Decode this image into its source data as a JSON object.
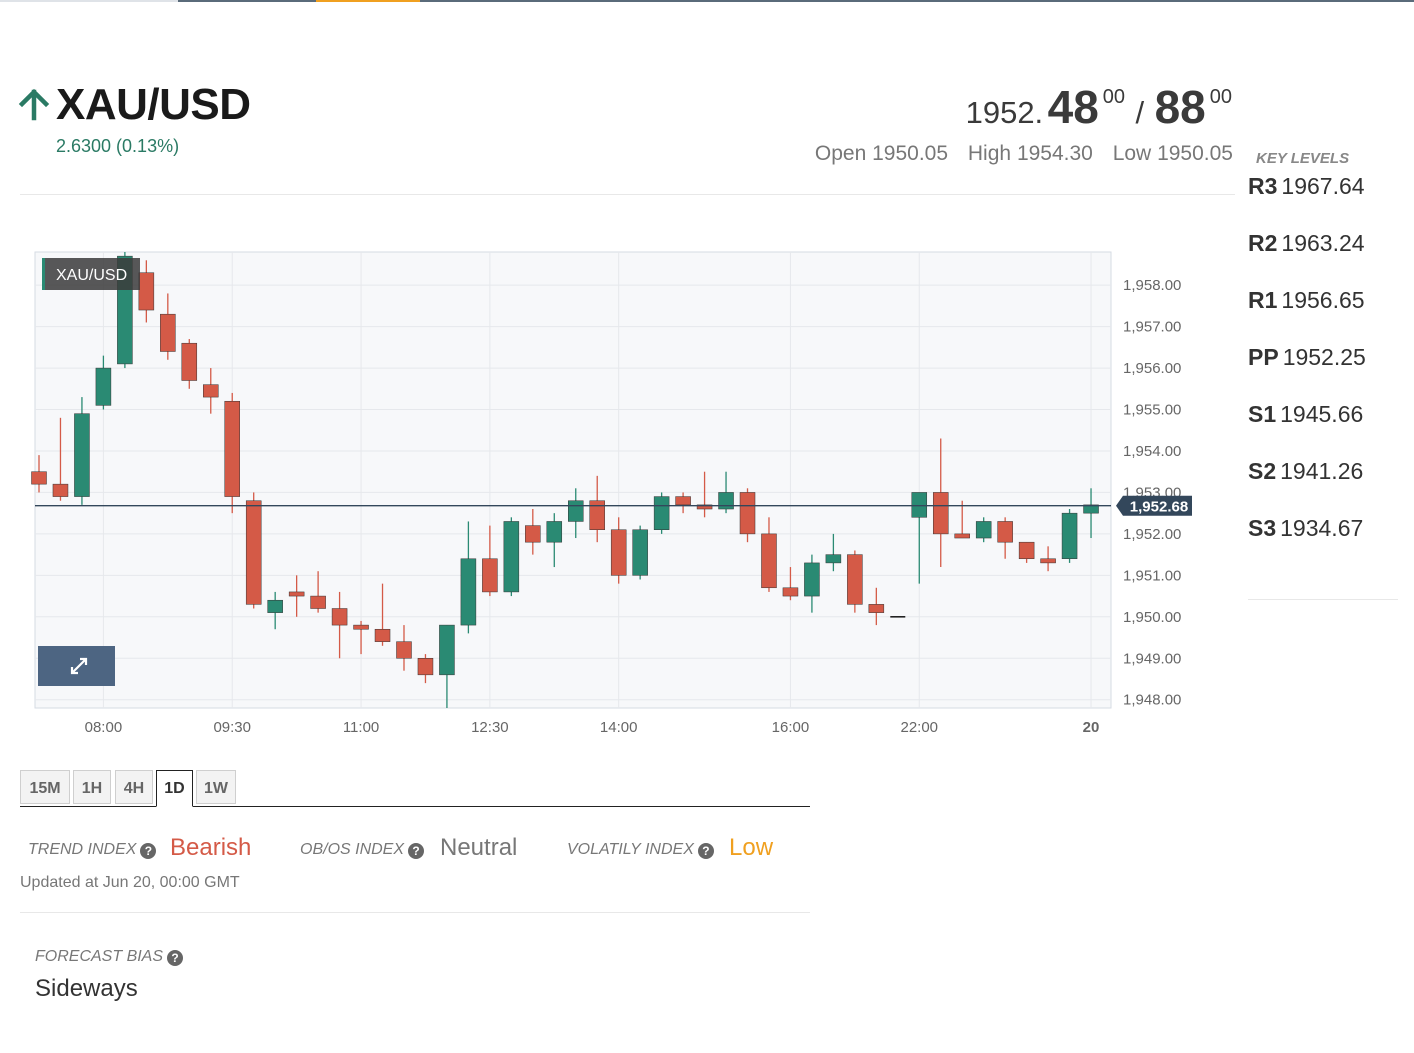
{
  "colors": {
    "up": "#2a8a73",
    "down": "#d45a47",
    "bearish": "#d45a47",
    "neutral": "#777777",
    "low": "#f0a020",
    "change": "#2a7a64",
    "price_tag": "#33475b",
    "expand_button": "#4d6582"
  },
  "header": {
    "symbol": "XAU/USD",
    "direction_icon": "arrow-up-icon",
    "change": "2.6300 (0.13%)",
    "bid_int": "1952.",
    "bid_dec": "48",
    "bid_sup": "00",
    "separator": "/",
    "ask_dec": "88",
    "ask_sup": "00",
    "open_label": "Open",
    "open": "1950.05",
    "high_label": "High",
    "high": "1954.30",
    "low_label": "Low",
    "low": "1950.05"
  },
  "key_levels": {
    "title": "KEY LEVELS",
    "levels": [
      {
        "name": "R3",
        "value": "1967.64"
      },
      {
        "name": "R2",
        "value": "1963.24"
      },
      {
        "name": "R1",
        "value": "1956.65"
      },
      {
        "name": "PP",
        "value": "1952.25"
      },
      {
        "name": "S1",
        "value": "1945.66"
      },
      {
        "name": "S2",
        "value": "1941.26"
      },
      {
        "name": "S3",
        "value": "1934.67"
      }
    ]
  },
  "chart_data": {
    "type": "candlestick",
    "title": "XAU/USD",
    "ylim": [
      1947.8,
      1958.8
    ],
    "y_ticks": [
      1948,
      1949,
      1950,
      1951,
      1952,
      1953,
      1954,
      1955,
      1956,
      1957,
      1958
    ],
    "y_tick_labels": [
      "1,948.00",
      "1,949.00",
      "1,950.00",
      "1,951.00",
      "1,952.00",
      "1,953.00",
      "1,954.00",
      "1,955.00",
      "1,956.00",
      "1,957.00",
      "1,958.00"
    ],
    "x_tick_labels": [
      "08:00",
      "09:30",
      "11:00",
      "12:30",
      "14:00",
      "16:00",
      "22:00",
      "20"
    ],
    "x_tick_bars": [
      3,
      9,
      15,
      21,
      27,
      35,
      41,
      49
    ],
    "current_price": 1952.68,
    "current_price_label": "1,952.68",
    "candles": [
      {
        "o": 1953.5,
        "h": 1953.9,
        "l": 1953.0,
        "c": 1953.2
      },
      {
        "o": 1953.2,
        "h": 1954.8,
        "l": 1952.8,
        "c": 1952.9
      },
      {
        "o": 1952.9,
        "h": 1955.3,
        "l": 1952.7,
        "c": 1954.9
      },
      {
        "o": 1955.1,
        "h": 1956.3,
        "l": 1955.0,
        "c": 1956.0
      },
      {
        "o": 1956.1,
        "h": 1958.8,
        "l": 1956.0,
        "c": 1958.7
      },
      {
        "o": 1958.3,
        "h": 1958.6,
        "l": 1957.1,
        "c": 1957.4
      },
      {
        "o": 1957.3,
        "h": 1957.8,
        "l": 1956.2,
        "c": 1956.4
      },
      {
        "o": 1956.6,
        "h": 1956.7,
        "l": 1955.5,
        "c": 1955.7
      },
      {
        "o": 1955.6,
        "h": 1956.0,
        "l": 1954.9,
        "c": 1955.3
      },
      {
        "o": 1955.2,
        "h": 1955.4,
        "l": 1952.5,
        "c": 1952.9
      },
      {
        "o": 1952.8,
        "h": 1953.0,
        "l": 1950.2,
        "c": 1950.3
      },
      {
        "o": 1950.1,
        "h": 1950.6,
        "l": 1949.7,
        "c": 1950.4
      },
      {
        "o": 1950.6,
        "h": 1951.0,
        "l": 1950.0,
        "c": 1950.5
      },
      {
        "o": 1950.5,
        "h": 1951.1,
        "l": 1950.1,
        "c": 1950.2
      },
      {
        "o": 1950.2,
        "h": 1950.6,
        "l": 1949.0,
        "c": 1949.8
      },
      {
        "o": 1949.8,
        "h": 1949.9,
        "l": 1949.1,
        "c": 1949.7
      },
      {
        "o": 1949.7,
        "h": 1950.8,
        "l": 1949.3,
        "c": 1949.4
      },
      {
        "o": 1949.4,
        "h": 1949.8,
        "l": 1948.7,
        "c": 1949.0
      },
      {
        "o": 1949.0,
        "h": 1949.1,
        "l": 1948.4,
        "c": 1948.6
      },
      {
        "o": 1948.6,
        "h": 1949.8,
        "l": 1947.8,
        "c": 1949.8
      },
      {
        "o": 1949.8,
        "h": 1952.3,
        "l": 1949.6,
        "c": 1951.4
      },
      {
        "o": 1951.4,
        "h": 1952.2,
        "l": 1950.5,
        "c": 1950.6
      },
      {
        "o": 1950.6,
        "h": 1952.4,
        "l": 1950.5,
        "c": 1952.3
      },
      {
        "o": 1952.2,
        "h": 1952.6,
        "l": 1951.5,
        "c": 1951.8
      },
      {
        "o": 1951.8,
        "h": 1952.5,
        "l": 1951.2,
        "c": 1952.3
      },
      {
        "o": 1952.3,
        "h": 1953.1,
        "l": 1951.9,
        "c": 1952.8
      },
      {
        "o": 1952.8,
        "h": 1953.4,
        "l": 1951.8,
        "c": 1952.1
      },
      {
        "o": 1952.1,
        "h": 1952.4,
        "l": 1950.8,
        "c": 1951.0
      },
      {
        "o": 1951.0,
        "h": 1952.2,
        "l": 1950.9,
        "c": 1952.1
      },
      {
        "o": 1952.1,
        "h": 1953.0,
        "l": 1952.0,
        "c": 1952.9
      },
      {
        "o": 1952.9,
        "h": 1953.0,
        "l": 1952.5,
        "c": 1952.7
      },
      {
        "o": 1952.7,
        "h": 1953.5,
        "l": 1952.4,
        "c": 1952.6
      },
      {
        "o": 1952.6,
        "h": 1953.5,
        "l": 1952.5,
        "c": 1953.0
      },
      {
        "o": 1953.0,
        "h": 1953.1,
        "l": 1951.8,
        "c": 1952.0
      },
      {
        "o": 1952.0,
        "h": 1952.4,
        "l": 1950.6,
        "c": 1950.7
      },
      {
        "o": 1950.7,
        "h": 1951.2,
        "l": 1950.4,
        "c": 1950.5
      },
      {
        "o": 1950.5,
        "h": 1951.5,
        "l": 1950.1,
        "c": 1951.3
      },
      {
        "o": 1951.3,
        "h": 1952.0,
        "l": 1951.1,
        "c": 1951.5
      },
      {
        "o": 1951.5,
        "h": 1951.6,
        "l": 1950.1,
        "c": 1950.3
      },
      {
        "o": 1950.3,
        "h": 1950.7,
        "l": 1949.8,
        "c": 1950.1
      },
      {
        "o": 1950.0,
        "h": 1950.0,
        "l": 1950.0,
        "c": 1950.0
      },
      {
        "o": 1952.4,
        "h": 1953.0,
        "l": 1950.8,
        "c": 1953.0
      },
      {
        "o": 1953.0,
        "h": 1954.3,
        "l": 1951.2,
        "c": 1952.0
      },
      {
        "o": 1952.0,
        "h": 1952.8,
        "l": 1951.9,
        "c": 1951.9
      },
      {
        "o": 1951.9,
        "h": 1952.4,
        "l": 1951.8,
        "c": 1952.3
      },
      {
        "o": 1952.3,
        "h": 1952.4,
        "l": 1951.4,
        "c": 1951.8
      },
      {
        "o": 1951.8,
        "h": 1951.8,
        "l": 1951.3,
        "c": 1951.4
      },
      {
        "o": 1951.4,
        "h": 1951.7,
        "l": 1951.1,
        "c": 1951.3
      },
      {
        "o": 1951.4,
        "h": 1952.6,
        "l": 1951.3,
        "c": 1952.5
      },
      {
        "o": 1952.5,
        "h": 1953.1,
        "l": 1951.9,
        "c": 1952.7
      }
    ]
  },
  "timeframes": [
    "15M",
    "1H",
    "4H",
    "1D",
    "1W"
  ],
  "active_timeframe": "1D",
  "indexes": {
    "trend_label": "TREND INDEX",
    "trend_value": "Bearish",
    "obos_label": "OB/OS INDEX",
    "obos_value": "Neutral",
    "volatility_label": "VOLATILY INDEX",
    "volatility_value": "Low",
    "updated": "Updated at Jun 20, 00:00 GMT"
  },
  "forecast": {
    "label": "FORECAST BIAS",
    "value": "Sideways"
  },
  "help_icon": "?"
}
